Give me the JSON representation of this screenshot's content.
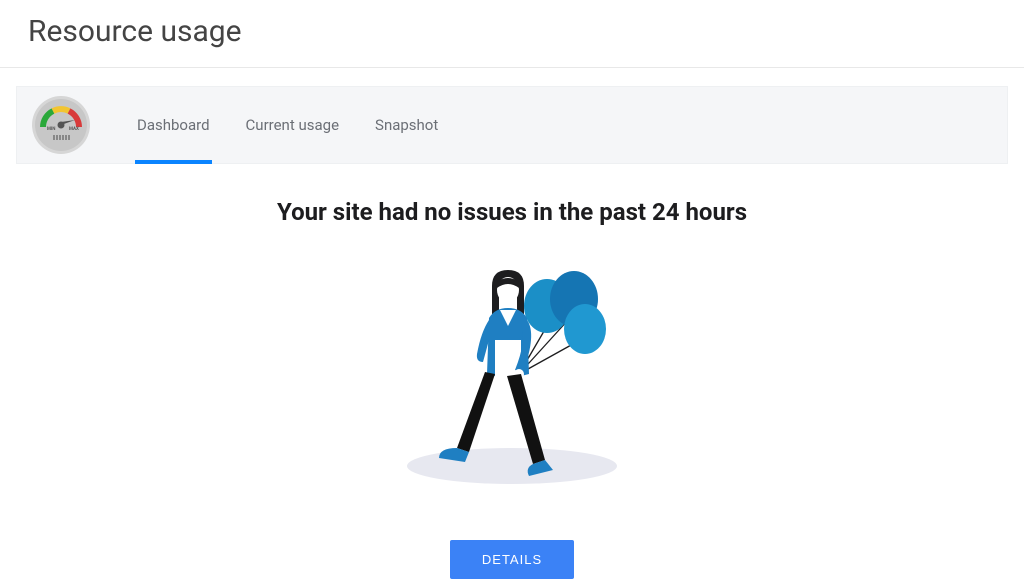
{
  "page": {
    "title": "Resource usage"
  },
  "tabs": {
    "dashboard": "Dashboard",
    "current_usage": "Current usage",
    "snapshot": "Snapshot"
  },
  "status": {
    "heading": "Your site had no issues in the past 24 hours"
  },
  "actions": {
    "details": "DETAILS"
  },
  "icons": {
    "gauge": "gauge-icon"
  },
  "colors": {
    "accent": "#3b82f6",
    "tab_active": "#0a84ff"
  }
}
